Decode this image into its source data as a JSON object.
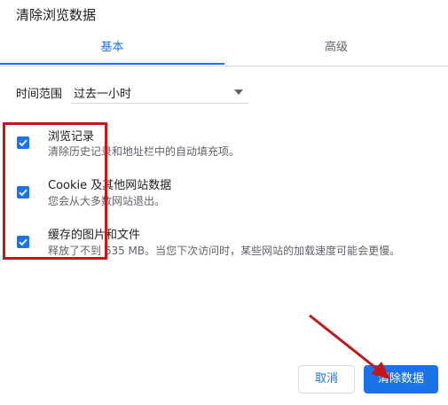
{
  "dialog": {
    "title": "清除浏览数据"
  },
  "tabs": [
    {
      "label": "基本",
      "active": true
    },
    {
      "label": "高级",
      "active": false
    }
  ],
  "time_range": {
    "label": "时间范围",
    "value": "过去一小时"
  },
  "options": [
    {
      "title": "浏览记录",
      "description": "清除历史记录和地址栏中的自动填充项。",
      "checked": true
    },
    {
      "title": "Cookie 及其他网站数据",
      "description": "您会从大多数网站退出。",
      "checked": true
    },
    {
      "title": "缓存的图片和文件",
      "description": "释放了不到 635 MB。当您下次访问时，某些网站的加载速度可能会更慢。",
      "checked": true
    }
  ],
  "buttons": {
    "cancel": "取消",
    "clear": "清除数据"
  },
  "colors": {
    "accent": "#1a73e8",
    "annotation": "#c0181c"
  }
}
